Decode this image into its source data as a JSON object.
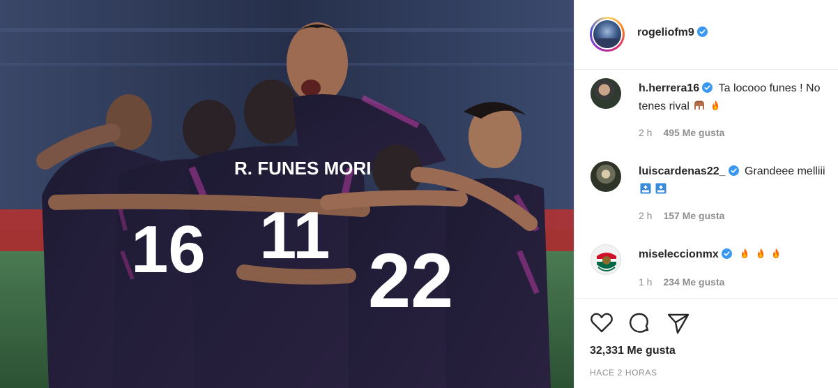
{
  "post": {
    "owner": {
      "username": "rogeliofm9",
      "verified": true
    },
    "photo": {
      "subject": "team-celebration-photo",
      "jersey_texts": [
        "R. FUNES MORI",
        "11",
        "16",
        "22"
      ]
    },
    "comments": [
      {
        "username": "h.herrera16",
        "verified": true,
        "text": "Ta locooo funes ! No tenes rival",
        "emojis": [
          "hands-raised-emoji",
          "fire-emoji"
        ],
        "time": "2 h",
        "likes": "495 Me gusta"
      },
      {
        "username": "luiscardenas22_",
        "verified": true,
        "text": "Grandeee melliii",
        "emojis": [
          "top-arrow-emoji",
          "top-arrow-emoji"
        ],
        "time": "2 h",
        "likes": "157 Me gusta"
      },
      {
        "username": "miseleccionmx",
        "verified": true,
        "text": "",
        "emojis": [
          "fire-emoji",
          "fire-emoji",
          "fire-emoji"
        ],
        "time": "1 h",
        "likes": "234 Me gusta"
      }
    ],
    "actions": {
      "like_icon": "heart-icon",
      "comment_icon": "comment-icon",
      "share_icon": "share-icon"
    },
    "likes_total": "32,331 Me gusta",
    "posted_ago": "HACE 2 HORAS",
    "colors": {
      "verified": "#3897f0",
      "text": "#262626",
      "muted": "#8e8e8e",
      "divider": "#efefef",
      "fire": "#ff6a00"
    }
  }
}
